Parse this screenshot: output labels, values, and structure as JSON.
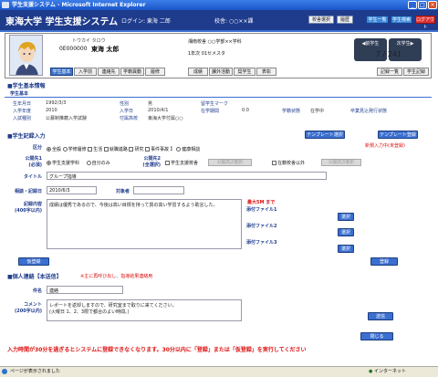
{
  "window": {
    "title": "学生支援システム - Microsoft Internet Explorer"
  },
  "header": {
    "app_name": "東海大学 学生支援システム",
    "login": "ログイン: 東海 二郎",
    "school": "校舎: ○○××課",
    "buttons": {
      "school_select": "校舎選択",
      "change": "履歴",
      "student_list": "学生一覧",
      "student_search": "学生検索",
      "logout": "ログアウト"
    }
  },
  "student": {
    "kana": "トウカイ タロウ",
    "id": "0E000000",
    "name": "東海 太郎",
    "campus_faculty": "湘南校舎  ○○学部××学科",
    "year_semester": "1年次  01セメスタ"
  },
  "nav": {
    "prev_label": "前学生",
    "next_label": "次学生",
    "counter": "7 / 241"
  },
  "tabs": [
    "学生基本",
    "入学前",
    "連絡先",
    "学籍異動",
    "履修",
    "成績",
    "課外活動",
    "奨学生",
    "表彰"
  ],
  "tab_buttons": {
    "record_list": "記録一覧",
    "student_record": "学生記録"
  },
  "basic": {
    "section_title": "■学生基本情報",
    "subsection": "学生基本",
    "rows": [
      [
        "生年月日",
        "1992/3/3",
        "性別",
        "男",
        "留学生マーク",
        "",
        "",
        "",
        "",
        ""
      ],
      [
        "入学年度",
        "2010",
        "入学日",
        "2010/4/1",
        "在学期間",
        "0.0",
        "学籍状態",
        "在学中",
        "卒業見込発行状態",
        ""
      ],
      [
        "入試種別",
        "公募制推薦入学試験",
        "付属高校",
        "東海大学付属○○",
        "",
        "",
        "",
        "",
        "",
        ""
      ]
    ]
  },
  "record": {
    "section_title": "■学生記録入力",
    "template_select": "テンプレート選択",
    "template_register": "テンプレート登録",
    "new_input_note": "新規入力中(未登録)",
    "category_label": "区分",
    "categories": [
      "全般",
      "学修履修",
      "生活",
      "就職進路",
      "研究",
      "事件事故",
      "健康相談"
    ],
    "category_sep": "】",
    "disclose_label": "公開先1",
    "disclose_sub": "(必須)",
    "disclose_opts": [
      "学生支援学科",
      "自分のみ"
    ],
    "disclose2_label": "公開先2",
    "disclose2_sub": "(全選択)",
    "disclose2_opt": "学生支援校舎",
    "disclose2_select_btn": "公開先2選択",
    "disclose2_chk": "在籍校舎以外",
    "disclose2_select_btn2": "公開先3選択",
    "title_label": "タイトル",
    "title_value": "グループ指導",
    "date_label": "相談・記録日",
    "date_value": "2010/6/3",
    "counterpart_label": "対象者",
    "content_label": "記録内容",
    "content_sub": "(400字以内)",
    "content_value": "成績は優秀であるので、今後は高い目標を持って質の高い学習するよう助言した。",
    "attach_max": "最大5M まで",
    "attach_labels": [
      "添付ファイル1",
      "添付ファイル2",
      "添付ファイル3"
    ],
    "select_label": "選択",
    "provisional_btn": "仮登録",
    "register_btn": "登録"
  },
  "contact": {
    "section_title": "■個人連絡【本送信】",
    "note": "※主に再呼び出し、指導結果連絡用",
    "subject_label": "件名",
    "subject_value": "連絡",
    "comment_label": "コメント",
    "comment_sub": "(200字以内)",
    "comment_value": "レポートを返却しますので、研究室まで取りに来てください。\n(火曜日 1、2、3限で都合のよい時間。)",
    "send_btn": "送信"
  },
  "close_btn": "閉じる",
  "warning": "入力時間が30分を過ぎるとシステムに登録できなくなります。30分以内に「登録」または「仮登録」を実行してください",
  "status": {
    "left": "ページが表示されました",
    "zone": "インターネット"
  },
  "colors": {
    "primary": "#1f3c8c",
    "accent": "#3b6fd0",
    "alert": "#dd1111"
  }
}
